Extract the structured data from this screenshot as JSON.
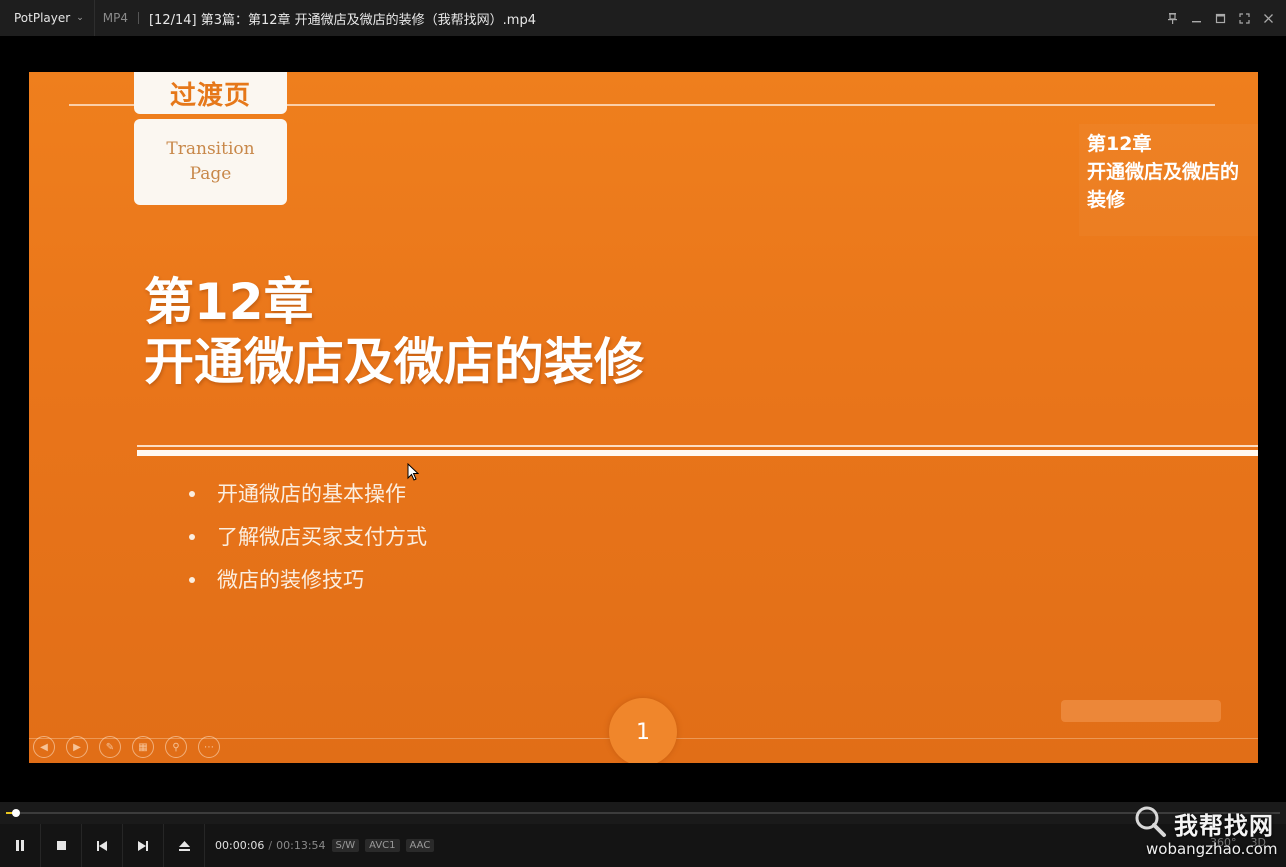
{
  "titlebar": {
    "app_name": "PotPlayer",
    "format": "MP4",
    "file_title": "[12/14] 第3篇：第12章 开通微店及微店的装修（我帮找网）.mp4"
  },
  "slide": {
    "tag_top": "过渡页",
    "tag_box_line1": "Transition",
    "tag_box_line2": "Page",
    "corner_line1": "第12章",
    "corner_line2": "开通微店及微店的",
    "corner_line3": "装修",
    "title_line1": "第12章",
    "title_line2": "开通微店及微店的装修",
    "bullets": [
      "开通微店的基本操作",
      "了解微店买家支付方式",
      "微店的装修技巧"
    ],
    "page_number": "1"
  },
  "playback": {
    "progress": 0.0075,
    "current_time": "00:00:06",
    "total_time": "00:13:54",
    "codec_tags": [
      "S/W",
      "AVC1",
      "AAC"
    ],
    "right_controls": [
      "360°",
      "3D"
    ]
  },
  "watermark": {
    "main": "我帮找网",
    "sub": "wobangzhao.com"
  },
  "colors": {
    "slide_orange": "#ef7f1d",
    "progress_yellow": "#e8c520"
  }
}
